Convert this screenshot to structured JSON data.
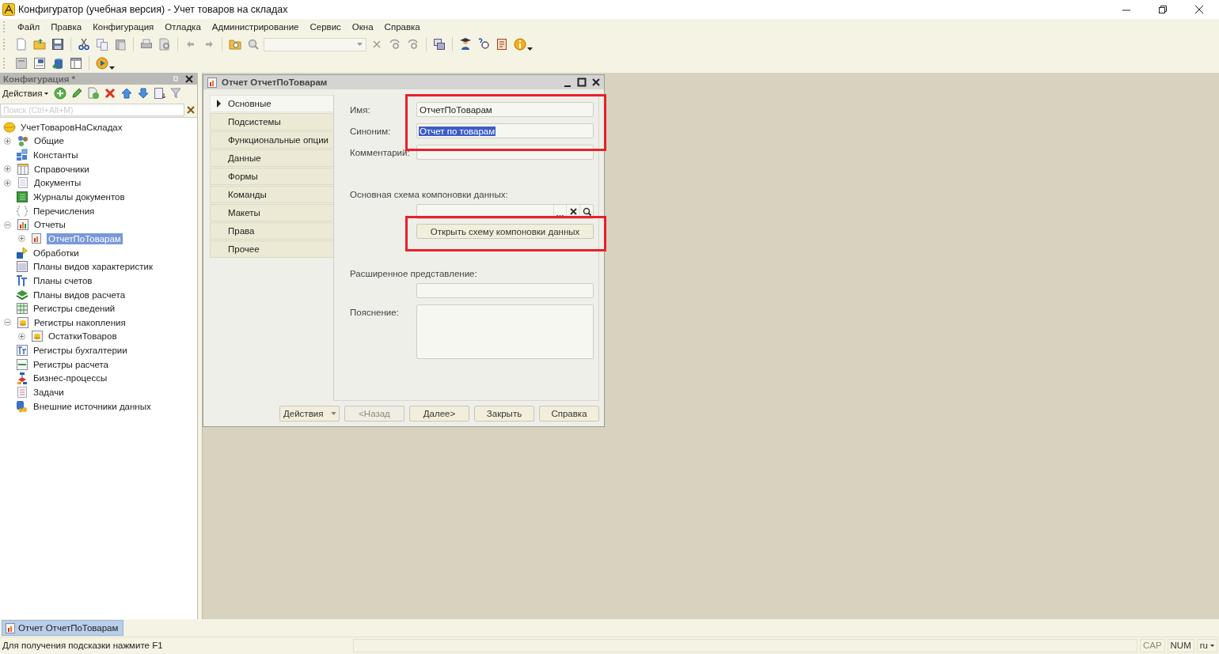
{
  "window": {
    "title": "Конфигуратор (учебная версия) - Учет товаров на складах"
  },
  "menu": [
    {
      "label": "Файл"
    },
    {
      "label": "Правка"
    },
    {
      "label": "Конфигурация"
    },
    {
      "label": "Отладка"
    },
    {
      "label": "Администрирование"
    },
    {
      "label": "Сервис"
    },
    {
      "label": "Окна"
    },
    {
      "label": "Справка"
    }
  ],
  "config_panel": {
    "title": "Конфигурация *",
    "actions_label": "Действия",
    "search": {
      "placeholder": "Поиск (Ctrl+Alt+M)"
    },
    "tree": [
      {
        "label": "УчетТоваровНаСкладах",
        "selected": false,
        "children": [
          {
            "label": "Общие",
            "expanded": false,
            "selected": false
          },
          {
            "label": "Константы",
            "selected": false
          },
          {
            "label": "Справочники",
            "expanded": false,
            "selected": false
          },
          {
            "label": "Документы",
            "expanded": false,
            "selected": false
          },
          {
            "label": "Журналы документов",
            "selected": false
          },
          {
            "label": "Перечисления",
            "selected": false
          },
          {
            "label": "Отчеты",
            "expanded": true,
            "selected": false,
            "children": [
              {
                "label": "ОтчетПоТоварам",
                "expanded": false,
                "selected": true
              }
            ]
          },
          {
            "label": "Обработки",
            "selected": false
          },
          {
            "label": "Планы видов характеристик",
            "selected": false
          },
          {
            "label": "Планы счетов",
            "selected": false
          },
          {
            "label": "Планы видов расчета",
            "selected": false
          },
          {
            "label": "Регистры сведений",
            "selected": false
          },
          {
            "label": "Регистры накопления",
            "expanded": true,
            "selected": false,
            "children": [
              {
                "label": "ОстаткиТоваров",
                "expanded": false,
                "selected": false
              }
            ]
          },
          {
            "label": "Регистры бухгалтерии",
            "selected": false
          },
          {
            "label": "Регистры расчета",
            "selected": false
          },
          {
            "label": "Бизнес-процессы",
            "selected": false
          },
          {
            "label": "Задачи",
            "selected": false
          },
          {
            "label": "Внешние источники данных",
            "selected": false
          }
        ]
      }
    ]
  },
  "dialog": {
    "title": "Отчет ОтчетПоТоварам",
    "tabs": [
      {
        "label": "Основные",
        "selected": true
      },
      {
        "label": "Подсистемы",
        "selected": false
      },
      {
        "label": "Функциональные опции",
        "selected": false
      },
      {
        "label": "Данные",
        "selected": false
      },
      {
        "label": "Формы",
        "selected": false
      },
      {
        "label": "Команды",
        "selected": false
      },
      {
        "label": "Макеты",
        "selected": false
      },
      {
        "label": "Права",
        "selected": false
      },
      {
        "label": "Прочее",
        "selected": false
      }
    ],
    "rows": [
      {
        "kind": "field",
        "label": "Имя:",
        "value": "ОтчетПоТоварам",
        "framed": true
      },
      {
        "kind": "field",
        "label": "Синоним:",
        "value": "Отчет по товарам",
        "text_selected": true,
        "framed": true
      },
      {
        "kind": "field",
        "label": "Комментарий:",
        "framed": false
      },
      {
        "kind": "heading",
        "label": "Основная схема компоновки данных:",
        "framed": false
      },
      {
        "kind": "picker",
        "framed": false
      },
      {
        "kind": "button",
        "label": "Открыть схему компоновки данных",
        "framed": true
      },
      {
        "kind": "heading",
        "label": "Расширенное представление:",
        "framed": false
      },
      {
        "kind": "field",
        "framed": false
      },
      {
        "kind": "textarea",
        "label": "Пояснение:",
        "framed": false
      }
    ],
    "buttons": [
      {
        "label": "Действия",
        "kind": "menu",
        "disabled": false
      },
      {
        "label": "<Назад",
        "kind": "plain",
        "disabled": true
      },
      {
        "label": "Далее>",
        "kind": "plain",
        "disabled": false
      },
      {
        "label": "Закрыть",
        "kind": "plain",
        "disabled": false
      },
      {
        "label": "Справка",
        "kind": "plain",
        "disabled": false
      }
    ]
  },
  "taskbar": [
    {
      "label": "Отчет ОтчетПоТоварам",
      "selected": true
    }
  ],
  "status_bar": {
    "hint": "Для получения подсказки нажмите F1",
    "indicators": [
      {
        "label": "CAP",
        "on": false
      },
      {
        "label": "NUM",
        "on": true
      }
    ],
    "language": "ru"
  }
}
